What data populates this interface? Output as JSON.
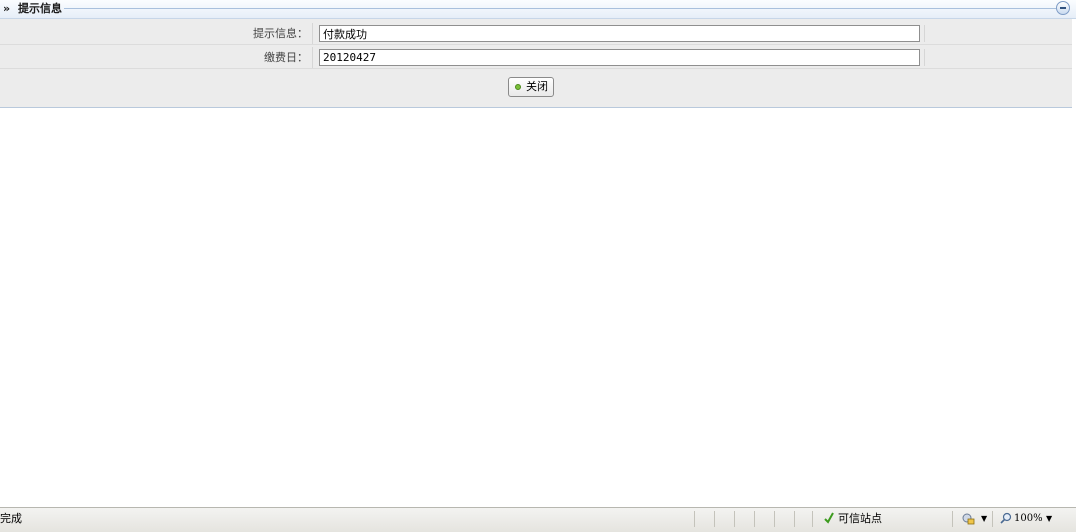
{
  "panel": {
    "arrows": "»",
    "title": "提示信息"
  },
  "form": {
    "rows": [
      {
        "label": "提示信息：",
        "value": "付款成功"
      },
      {
        "label": "缴费日：",
        "value": "20120427"
      }
    ],
    "close_button": "关闭"
  },
  "status_bar": {
    "text": "完成",
    "zone": "可信站点",
    "zoom": "100%",
    "dropdown": "▼"
  },
  "colors": {
    "header_rule": "#a9c0dd",
    "check": "#3d9b1f",
    "button_dot": "#7bbf3a"
  }
}
